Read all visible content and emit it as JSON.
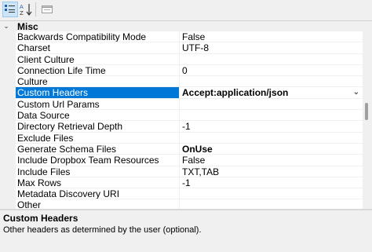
{
  "toolbar": {
    "buttons": [
      {
        "name": "categorized-view-icon",
        "glyph": "▤",
        "pressed": true
      },
      {
        "name": "alphabetical-sort-icon",
        "glyph": "A↓",
        "pressed": false
      },
      {
        "name": "property-pages-icon",
        "glyph": "▭",
        "pressed": false
      }
    ]
  },
  "category": {
    "toggle": "⌄",
    "label": "Misc"
  },
  "properties": [
    {
      "name": "Backwards Compatibility Mode",
      "value": "False"
    },
    {
      "name": "Charset",
      "value": "UTF-8"
    },
    {
      "name": "Client Culture",
      "value": ""
    },
    {
      "name": "Connection Life Time",
      "value": "0"
    },
    {
      "name": "Culture",
      "value": ""
    },
    {
      "name": "Custom Headers",
      "value": "Accept:application/json"
    },
    {
      "name": "Custom Url Params",
      "value": ""
    },
    {
      "name": "Data Source",
      "value": ""
    },
    {
      "name": "Directory Retrieval Depth",
      "value": "-1"
    },
    {
      "name": "Exclude Files",
      "value": ""
    },
    {
      "name": "Generate Schema Files",
      "value": "OnUse"
    },
    {
      "name": "Include Dropbox Team Resources",
      "value": "False"
    },
    {
      "name": "Include Files",
      "value": "TXT,TAB"
    },
    {
      "name": "Max Rows",
      "value": "-1"
    },
    {
      "name": "Metadata Discovery URI",
      "value": ""
    },
    {
      "name": "Other",
      "value": ""
    }
  ],
  "selected_index": 5,
  "bold_value_index": 10,
  "dropdown_glyph": "⌄",
  "description": {
    "title": "Custom Headers",
    "text": "Other headers as determined by the user (optional)."
  }
}
